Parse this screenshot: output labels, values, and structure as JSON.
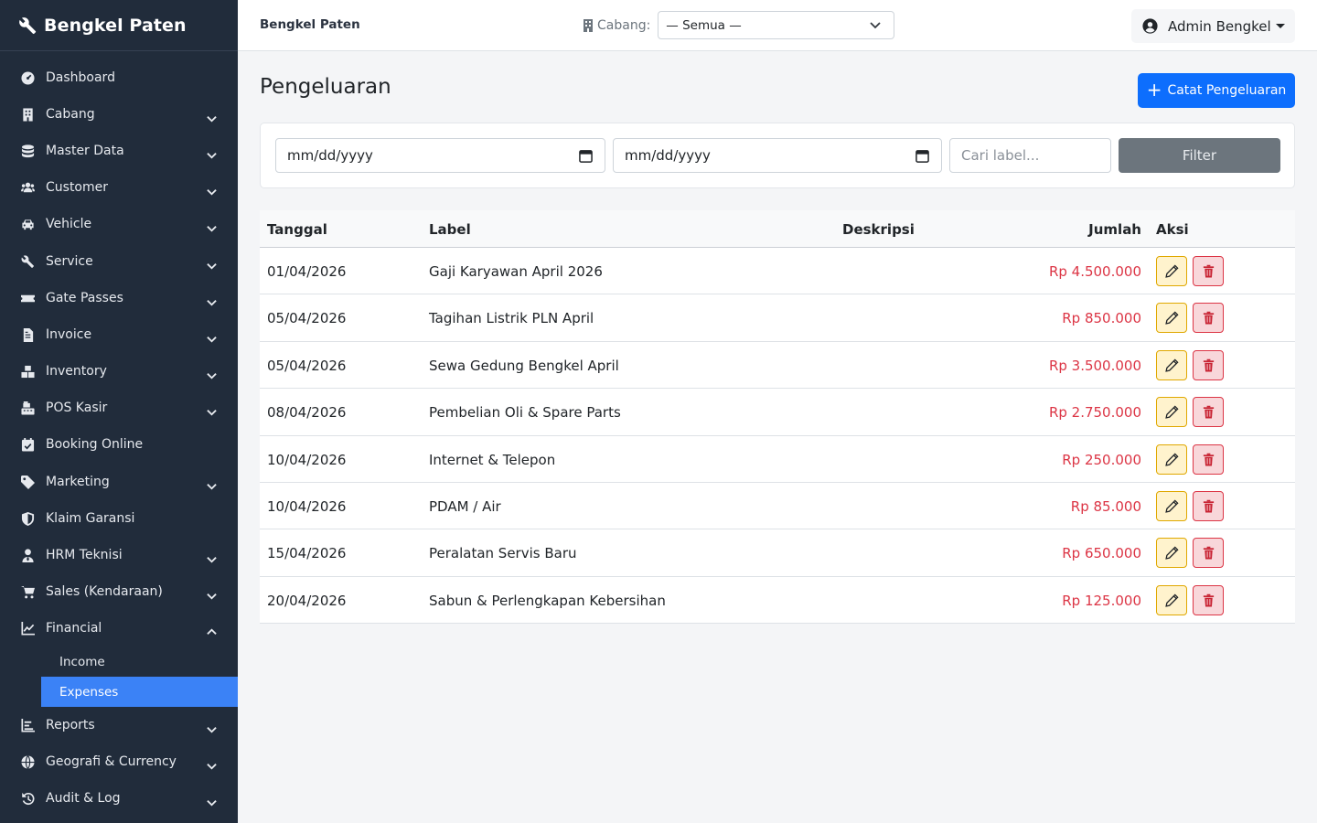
{
  "brand": {
    "title": "Bengkel Paten"
  },
  "sidebar": {
    "items": [
      {
        "label": "Dashboard",
        "icon": "dashboard-icon",
        "has_children": false
      },
      {
        "label": "Cabang",
        "icon": "building-icon",
        "has_children": true
      },
      {
        "label": "Master Data",
        "icon": "database-icon",
        "has_children": true
      },
      {
        "label": "Customer",
        "icon": "users-icon",
        "has_children": true
      },
      {
        "label": "Vehicle",
        "icon": "car-icon",
        "has_children": true
      },
      {
        "label": "Service",
        "icon": "tools-icon",
        "has_children": true
      },
      {
        "label": "Gate Passes",
        "icon": "ticket-icon",
        "has_children": true
      },
      {
        "label": "Invoice",
        "icon": "invoice-icon",
        "has_children": true
      },
      {
        "label": "Inventory",
        "icon": "boxes-icon",
        "has_children": true
      },
      {
        "label": "POS Kasir",
        "icon": "cash-register-icon",
        "has_children": true
      },
      {
        "label": "Booking Online",
        "icon": "calendar-check-icon",
        "has_children": false
      },
      {
        "label": "Marketing",
        "icon": "tag-icon",
        "has_children": true
      },
      {
        "label": "Klaim Garansi",
        "icon": "shield-icon",
        "has_children": false
      },
      {
        "label": "HRM Teknisi",
        "icon": "user-tie-icon",
        "has_children": true
      },
      {
        "label": "Sales (Kendaraan)",
        "icon": "cart-icon",
        "has_children": true
      },
      {
        "label": "Financial",
        "icon": "chart-line-icon",
        "has_children": true,
        "expanded": true
      },
      {
        "label": "Reports",
        "icon": "chart-bar-icon",
        "has_children": true
      },
      {
        "label": "Geografi & Currency",
        "icon": "globe-icon",
        "has_children": true
      },
      {
        "label": "Audit & Log",
        "icon": "history-icon",
        "has_children": true
      }
    ],
    "financial_sub": [
      {
        "label": "Income",
        "active": false
      },
      {
        "label": "Expenses",
        "active": true
      }
    ]
  },
  "topbar": {
    "title": "Bengkel Paten",
    "branch_label": "Cabang:",
    "branch_value": "— Semua —",
    "user_name": "Admin Bengkel"
  },
  "page": {
    "title": "Pengeluaran",
    "add_button": "Catat Pengeluaran"
  },
  "filters": {
    "date_from": "mm/dd/yyyy",
    "date_to": "mm/dd/yyyy",
    "search_placeholder": "Cari label...",
    "filter_button": "Filter"
  },
  "table": {
    "headers": {
      "date": "Tanggal",
      "label": "Label",
      "description": "Deskripsi",
      "amount": "Jumlah",
      "actions": "Aksi"
    },
    "rows": [
      {
        "date": "01/04/2026",
        "label": "Gaji Karyawan April 2026",
        "description": "",
        "amount": "Rp 4.500.000"
      },
      {
        "date": "05/04/2026",
        "label": "Tagihan Listrik PLN April",
        "description": "",
        "amount": "Rp 850.000"
      },
      {
        "date": "05/04/2026",
        "label": "Sewa Gedung Bengkel April",
        "description": "",
        "amount": "Rp 3.500.000"
      },
      {
        "date": "08/04/2026",
        "label": "Pembelian Oli & Spare Parts",
        "description": "",
        "amount": "Rp 2.750.000"
      },
      {
        "date": "10/04/2026",
        "label": "Internet & Telepon",
        "description": "",
        "amount": "Rp 250.000"
      },
      {
        "date": "10/04/2026",
        "label": "PDAM / Air",
        "description": "",
        "amount": "Rp 85.000"
      },
      {
        "date": "15/04/2026",
        "label": "Peralatan Servis Baru",
        "description": "",
        "amount": "Rp 650.000"
      },
      {
        "date": "20/04/2026",
        "label": "Sabun & Perlengkapan Kebersihan",
        "description": "",
        "amount": "Rp 125.000"
      }
    ]
  },
  "colors": {
    "sidebar_bg": "#212c3b",
    "active_item": "#3b82f6",
    "primary": "#0d6efd",
    "amount_red": "#dc3545",
    "filter_btn": "#6c757d"
  }
}
